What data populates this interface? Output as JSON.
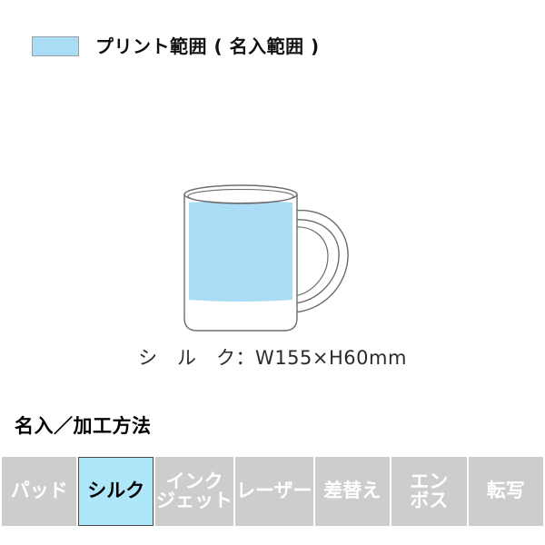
{
  "legend": {
    "swatch_name": "print-area-swatch",
    "swatch_color": "#aadcf5",
    "swatch_border_color": "#9aa0a6",
    "label": "プリント範囲 ( 名入範囲 )"
  },
  "figure": {
    "product": "mug",
    "outline_color": "#6b6b6b",
    "print_area_color": "#aadcf5",
    "dimension_caption": "シ　ル　ク：W155×H60mm"
  },
  "methods": {
    "heading": "名入／加工方法",
    "active_color": "#aee6fa",
    "inactive_color": "#cdcdcd",
    "items": [
      {
        "name": "pad",
        "lines": [
          "パッド"
        ],
        "active": false
      },
      {
        "name": "silk",
        "lines": [
          "シルク"
        ],
        "active": true
      },
      {
        "name": "inkjet",
        "lines": [
          "インク",
          "ジェット"
        ],
        "active": false
      },
      {
        "name": "laser",
        "lines": [
          "レーザー"
        ],
        "active": false
      },
      {
        "name": "replace",
        "lines": [
          "差替え"
        ],
        "active": false
      },
      {
        "name": "emboss",
        "lines": [
          "エン",
          "ボス"
        ],
        "active": false
      },
      {
        "name": "transfer",
        "lines": [
          "転写"
        ],
        "active": false
      }
    ]
  }
}
